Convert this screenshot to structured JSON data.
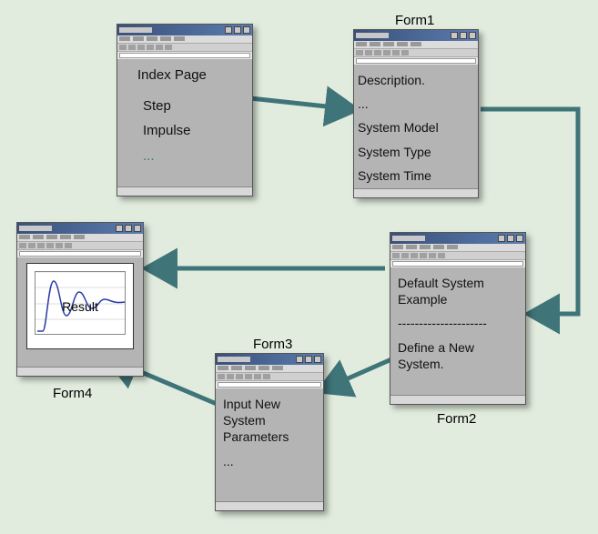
{
  "labels": {
    "form1": "Form1",
    "form2": "Form2",
    "form3": "Form3",
    "form4": "Form4"
  },
  "index_window": {
    "title": "Index Page",
    "item1": "Step",
    "item2": "Impulse",
    "ellipsis": "..."
  },
  "form1_window": {
    "line1": "Description.",
    "ellipsis": "...",
    "line2": "System Model",
    "line3": "System Type",
    "line4": "System Time"
  },
  "form2_window": {
    "line1": "Default System Example",
    "divider": "---------------------",
    "line2": "Define a New System."
  },
  "form3_window": {
    "line1": "Input New System Parameters",
    "ellipsis": "..."
  },
  "form4_window": {
    "result_label": "Result"
  }
}
